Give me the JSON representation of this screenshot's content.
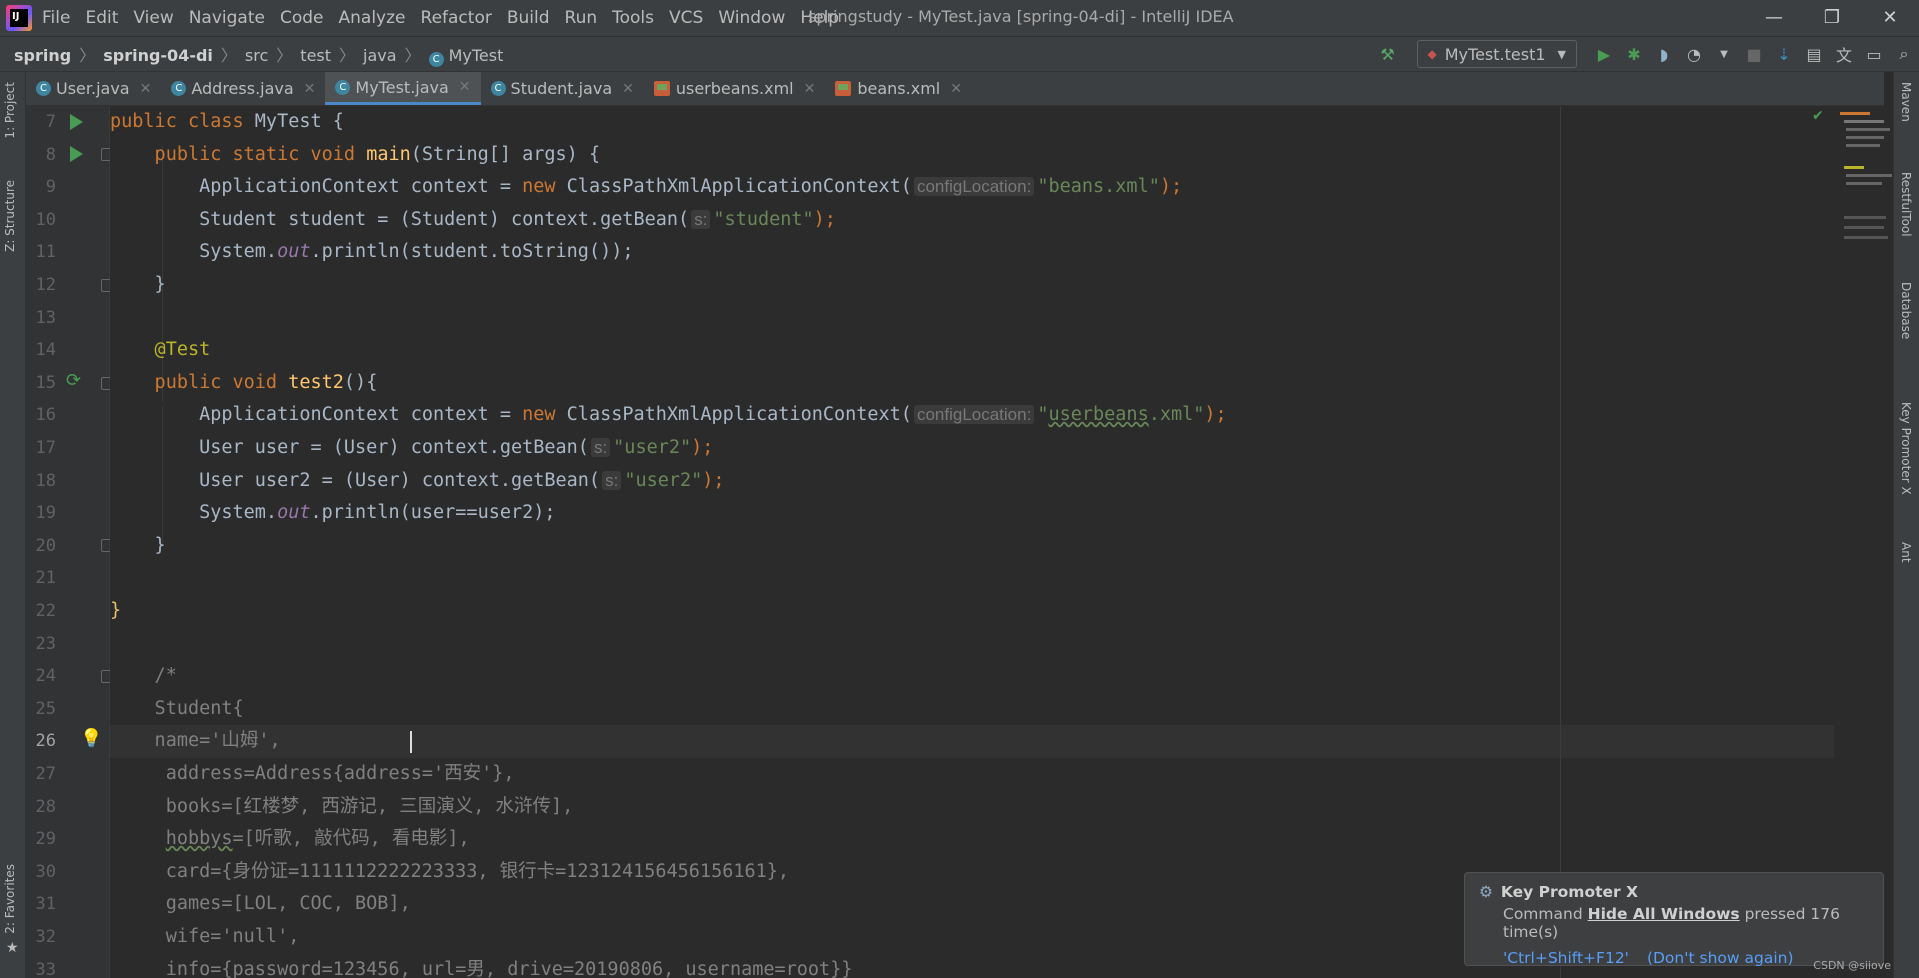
{
  "window": {
    "title": "springstudy - MyTest.java [spring-04-di] - IntelliJ IDEA",
    "minimize": "—",
    "restore": "❐",
    "close": "✕"
  },
  "menu": [
    "File",
    "Edit",
    "View",
    "Navigate",
    "Code",
    "Analyze",
    "Refactor",
    "Build",
    "Run",
    "Tools",
    "VCS",
    "Window",
    "Help"
  ],
  "breadcrumb": [
    "spring",
    "spring-04-di",
    "src",
    "test",
    "java",
    "MyTest"
  ],
  "run_config": "MyTest.test1",
  "tabs": [
    "User.java",
    "Address.java",
    "MyTest.java",
    "Student.java",
    "userbeans.xml",
    "beans.xml"
  ],
  "left_panels": {
    "project": "1: Project",
    "structure": "Z: Structure",
    "favorites": "2: Favorites"
  },
  "right_panels": {
    "maven": "Maven",
    "restful": "RestfulTool",
    "database": "Database",
    "keypromoter": "Key Promoter X",
    "ant": "Ant"
  },
  "line_numbers": [
    "7",
    "8",
    "9",
    "10",
    "11",
    "12",
    "13",
    "14",
    "15",
    "16",
    "17",
    "18",
    "19",
    "20",
    "21",
    "22",
    "23",
    "24",
    "25",
    "26",
    "27",
    "28",
    "29",
    "30",
    "31",
    "32",
    "33"
  ],
  "hints": {
    "config": "configLocation:",
    "s": "s:"
  },
  "code": {
    "l7_a": "public class ",
    "l7_b": "MyTest {",
    "l8_a": "    public static void ",
    "l8_b": "main",
    "l8_c": "(String[] args) {",
    "l9_a": "        ApplicationContext context = ",
    "l9_b": "new ",
    "l9_c": "ClassPathXmlApplicationContext(",
    "l9_d": "\"beans.xml\"",
    "l9_e": ");",
    "l10_a": "        Student student = (Student) context.getBean(",
    "l10_b": "\"student\"",
    "l10_c": ");",
    "l11_a": "        System.",
    "l11_b": "out",
    "l11_c": ".println(student.toString());",
    "l12": "    }",
    "l14": "    @Test",
    "l15_a": "    public void ",
    "l15_b": "test2",
    "l15_c": "(){",
    "l16_a": "        ApplicationContext context = ",
    "l16_b": "new ",
    "l16_c": "ClassPathXmlApplicationContext(",
    "l16_d1": "\"",
    "l16_d2": "userbeans",
    "l16_d3": ".xml\"",
    "l16_e": ");",
    "l17_a": "        User user = (User) context.getBean(",
    "l17_b": "\"user2\"",
    "l17_c": ");",
    "l18_a": "        User user2 = (User) context.getBean(",
    "l18_b": "\"user2\"",
    "l18_c": ");",
    "l19_a": "        System.",
    "l19_b": "out",
    "l19_c": ".println(user==user2);",
    "l20": "    }",
    "l22": "}",
    "l24": "    /*",
    "l25": "    Student{",
    "l26": "    name='山姆',",
    "l27": "     address=Address{address='西安'},",
    "l28": "     books=[红楼梦, 西游记, 三国演义, 水浒传],",
    "l29_a": "     ",
    "l29_b": "hobbys",
    "l29_c": "=[听歌, 敲代码, 看电影],",
    "l30": "     card={身份证=1111112222223333, 银行卡=123124156456156161},",
    "l31": "     games=[LOL, COC, BOB],",
    "l32": "     wife='null',",
    "l33": "     info={password=123456, url=男, drive=20190806, username=root}}"
  },
  "popup": {
    "title": "Key Promoter X",
    "text_a": "Command ",
    "command": "Hide All Windows",
    "text_b": " pressed 176 time(s)",
    "shortcut": "'Ctrl+Shift+F12'",
    "dismiss": "(Don't show again)"
  },
  "watermark": "CSDN @siiove"
}
